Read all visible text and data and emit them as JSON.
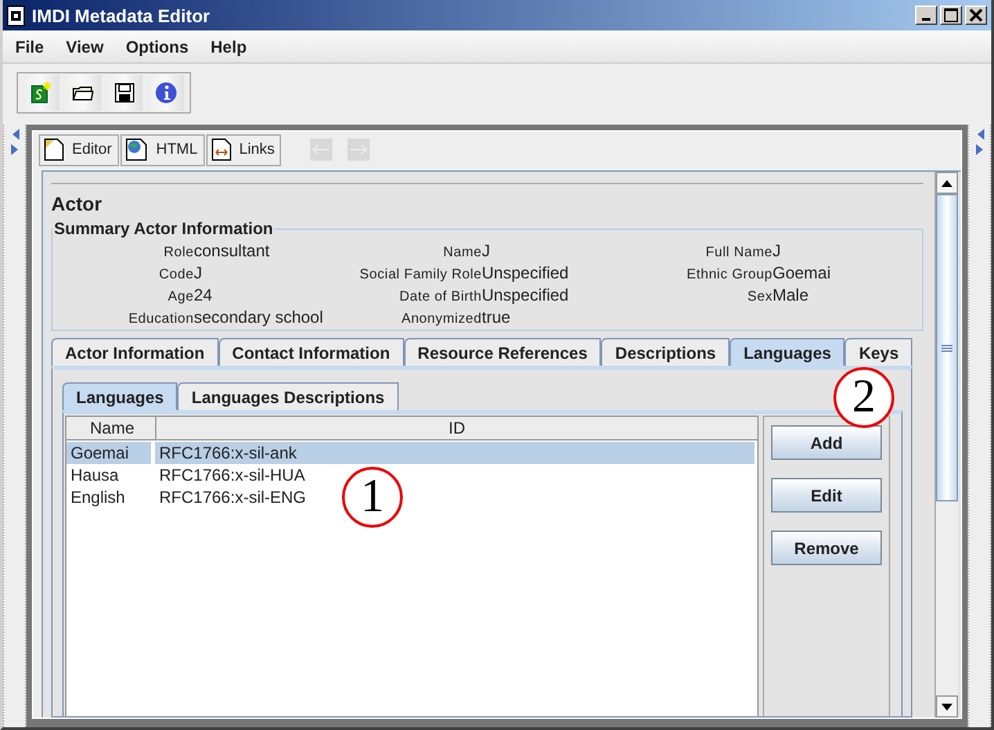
{
  "window": {
    "title": "IMDI Metadata Editor"
  },
  "menu": [
    "File",
    "View",
    "Options",
    "Help"
  ],
  "view_buttons": [
    {
      "label": "Editor",
      "kind": "editor"
    },
    {
      "label": "HTML",
      "kind": "html"
    },
    {
      "label": "Links",
      "kind": "links"
    }
  ],
  "section_title": "Actor",
  "summary": {
    "title": "Summary Actor Information",
    "fields": [
      {
        "label": "Role",
        "value": "consultant"
      },
      {
        "label": "Name",
        "value": "J"
      },
      {
        "label": "Full Name",
        "value": "J"
      },
      {
        "label": "Code",
        "value": "J"
      },
      {
        "label": "Social Family Role",
        "value": "Unspecified"
      },
      {
        "label": "Ethnic Group",
        "value": "Goemai"
      },
      {
        "label": "Age",
        "value": "24"
      },
      {
        "label": "Date of Birth",
        "value": "Unspecified"
      },
      {
        "label": "Sex",
        "value": "Male"
      },
      {
        "label": "Education",
        "value": "secondary school"
      },
      {
        "label": "Anonymized",
        "value": "true"
      }
    ]
  },
  "tabs": [
    {
      "label": "Actor Information",
      "selected": false
    },
    {
      "label": "Contact Information",
      "selected": false
    },
    {
      "label": "Resource References",
      "selected": false
    },
    {
      "label": "Descriptions",
      "selected": false
    },
    {
      "label": "Languages",
      "selected": true
    },
    {
      "label": "Keys",
      "selected": false
    }
  ],
  "subtabs": [
    {
      "label": "Languages",
      "selected": true
    },
    {
      "label": "Languages Descriptions",
      "selected": false
    }
  ],
  "table": {
    "columns": [
      "Name",
      "ID"
    ],
    "rows": [
      {
        "name": "Goemai",
        "id": "RFC1766:x-sil-ank",
        "selected": true
      },
      {
        "name": "Hausa",
        "id": "RFC1766:x-sil-HUA",
        "selected": false
      },
      {
        "name": "English",
        "id": "RFC1766:x-sil-ENG",
        "selected": false
      }
    ]
  },
  "buttons": [
    "Add",
    "Edit",
    "Remove"
  ],
  "annotations": [
    {
      "label": "1"
    },
    {
      "label": "2"
    }
  ]
}
